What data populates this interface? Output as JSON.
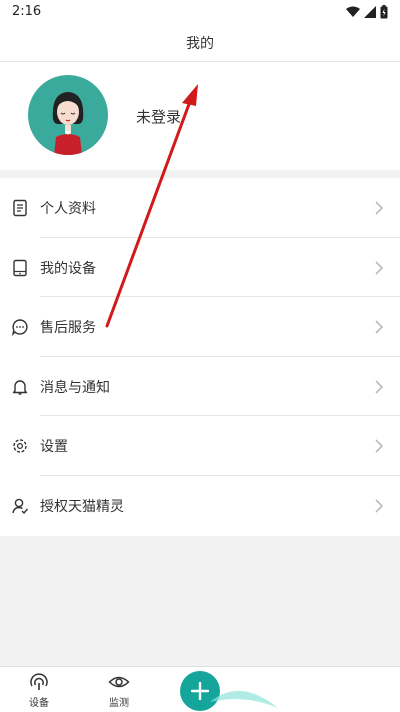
{
  "status_bar": {
    "time": "2:16"
  },
  "header": {
    "title": "我的"
  },
  "profile": {
    "username": "未登录"
  },
  "menu": {
    "items": [
      {
        "label": "个人资料",
        "icon": "document-icon"
      },
      {
        "label": "我的设备",
        "icon": "tablet-device-icon"
      },
      {
        "label": "售后服务",
        "icon": "chat-bubble-icon"
      },
      {
        "label": "消息与通知",
        "icon": "bell-icon"
      },
      {
        "label": "设置",
        "icon": "gear-icon"
      },
      {
        "label": "授权天猫精灵",
        "icon": "user-authorize-icon"
      }
    ]
  },
  "tabbar": {
    "tabs": [
      {
        "label": "设备",
        "icon": "device-signal-icon"
      },
      {
        "label": "监测",
        "icon": "eye-icon"
      }
    ],
    "fab_icon": "plus-icon"
  },
  "colors": {
    "accent": "#15a59a",
    "avatar_bg": "#3aaa9c",
    "annotation_arrow": "#d11a1a"
  }
}
